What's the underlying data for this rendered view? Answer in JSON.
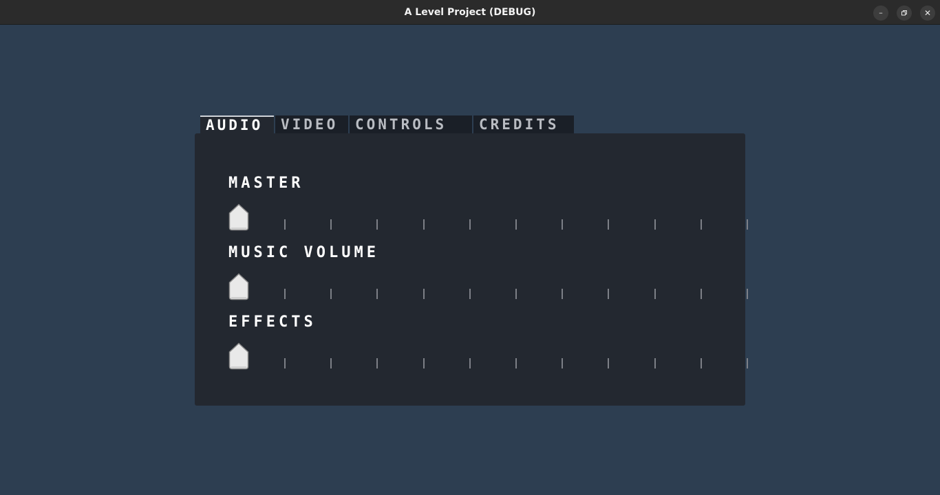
{
  "window": {
    "title": "A Level Project (DEBUG)",
    "minimize_glyph": "–",
    "close_glyph": "✕"
  },
  "tabs": [
    {
      "label": "AUDIO",
      "active": true
    },
    {
      "label": "VIDEO",
      "active": false
    },
    {
      "label": "CONTROLS",
      "active": false
    },
    {
      "label": "CREDITS",
      "active": false
    }
  ],
  "audio": {
    "sliders": [
      {
        "label": "MASTER",
        "value": 0,
        "ticks": 11
      },
      {
        "label": "MUSIC VOLUME",
        "value": 0,
        "ticks": 11
      },
      {
        "label": "EFFECTS",
        "value": 0,
        "ticks": 11
      }
    ]
  },
  "colors": {
    "background": "#2d3e51",
    "panel": "#232830",
    "tab_inactive": "#1a1f27",
    "tick": "#7d8087",
    "grabber_fill": "#e9e9e9",
    "grabber_outline": "#8a8a8a"
  }
}
